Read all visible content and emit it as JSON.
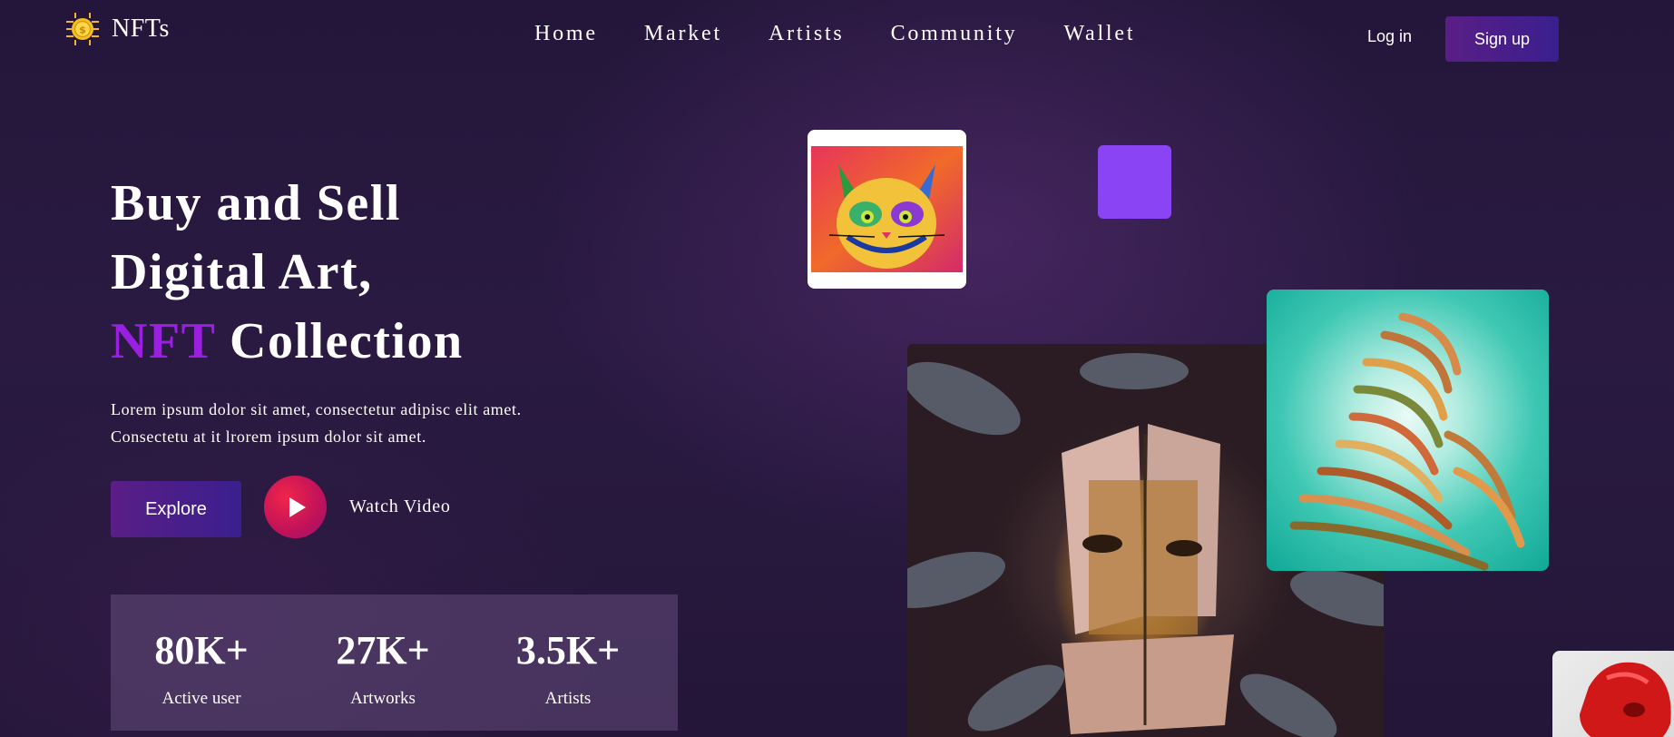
{
  "brand": {
    "name": "NFTs",
    "logo_icon": "coin-chip-icon"
  },
  "nav": {
    "items": [
      "Home",
      "Market",
      "Artists",
      "Community",
      "Wallet"
    ]
  },
  "auth": {
    "login_label": "Log in",
    "signup_label": "Sign up"
  },
  "hero": {
    "title_line1": "Buy and Sell",
    "title_line2": "Digital Art,",
    "title_accent": "NFT",
    "title_line3_rest": " Collection",
    "description_line1": "Lorem ipsum dolor sit amet, consectetur adipisc elit amet.",
    "description_line2": "Consectetu at it lrorem ipsum dolor sit amet.",
    "explore_label": "Explore",
    "watch_label": "Watch Video",
    "play_icon": "play-icon"
  },
  "stats": [
    {
      "value": "80K+",
      "label": "Active user"
    },
    {
      "value": "27K+",
      "label": "Artworks"
    },
    {
      "value": "3.5K+",
      "label": "Artists"
    }
  ],
  "colors": {
    "accent": "#9a1fe0",
    "button_gradient_start": "#5a1e86",
    "button_gradient_end": "#3a1f8e",
    "purple_square": "#8a44f4",
    "play_red": "#e01848"
  }
}
